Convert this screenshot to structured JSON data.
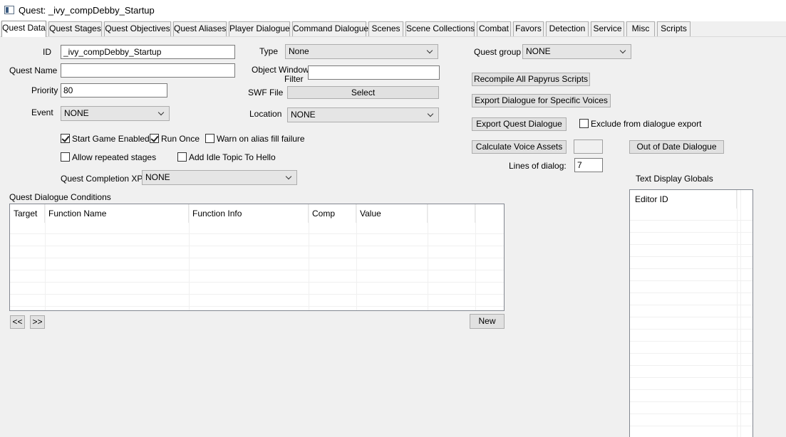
{
  "window": {
    "title": "Quest: _ivy_compDebby_Startup"
  },
  "tabs": [
    {
      "label": "Quest Data"
    },
    {
      "label": "Quest Stages"
    },
    {
      "label": "Quest Objectives"
    },
    {
      "label": "Quest Aliases"
    },
    {
      "label": "Player Dialogue"
    },
    {
      "label": "Command Dialogue"
    },
    {
      "label": "Scenes"
    },
    {
      "label": "Scene Collections"
    },
    {
      "label": "Combat"
    },
    {
      "label": "Favors"
    },
    {
      "label": "Detection"
    },
    {
      "label": "Service"
    },
    {
      "label": "Misc"
    },
    {
      "label": "Scripts"
    }
  ],
  "form": {
    "id_label": "ID",
    "id_value": "_ivy_compDebby_Startup",
    "quest_name_label": "Quest Name",
    "quest_name_value": "",
    "priority_label": "Priority",
    "priority_value": "80",
    "event_label": "Event",
    "event_value": "NONE",
    "type_label": "Type",
    "type_value": "None",
    "object_window_label_1": "Object Window",
    "object_window_label_2": "Filter",
    "object_window_value": "",
    "swf_label": "SWF File",
    "swf_button": "Select",
    "location_label": "Location",
    "location_value": "NONE",
    "start_game_enabled": "Start Game Enabled",
    "run_once": "Run Once",
    "warn_alias": "Warn on alias fill failure",
    "allow_repeated": "Allow repeated stages",
    "add_idle": "Add Idle Topic To Hello",
    "completion_xp_label": "Quest Completion XP",
    "completion_xp_value": "NONE",
    "quest_group_label": "Quest group",
    "quest_group_value": "NONE"
  },
  "actions": {
    "recompile": "Recompile All Papyrus Scripts",
    "export_voices": "Export Dialogue for Specific Voices",
    "export_quest": "Export Quest Dialogue",
    "exclude_export": "Exclude from dialogue export",
    "calc_voice": "Calculate Voice Assets",
    "calc_value": "",
    "out_of_date": "Out of Date Dialogue",
    "lines_label": "Lines of dialog:",
    "lines_value": "7"
  },
  "conditions": {
    "label": "Quest Dialogue Conditions",
    "columns": [
      "Target",
      "Function Name",
      "Function Info",
      "Comp",
      "Value"
    ],
    "rows": [],
    "prev_button": "<<",
    "next_button": ">>",
    "new_button": "New"
  },
  "globals": {
    "label": "Text Display Globals",
    "columns": [
      "Editor ID"
    ],
    "rows": []
  },
  "checkbox_states": {
    "start_game_enabled": true,
    "run_once": true,
    "warn_alias": false,
    "allow_repeated": false,
    "add_idle": false,
    "exclude_export": false
  }
}
